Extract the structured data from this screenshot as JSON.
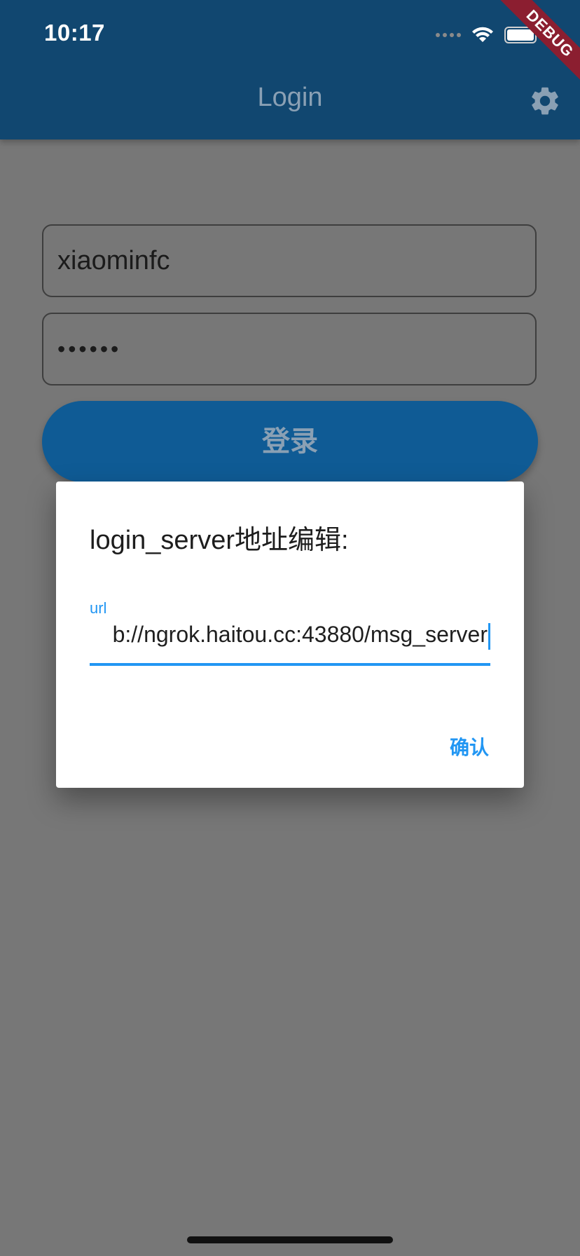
{
  "status_bar": {
    "time": "10:17"
  },
  "app_bar": {
    "title": "Login",
    "debug_banner": "DEBUG",
    "background_color": "#114770"
  },
  "login_form": {
    "username": "xiaominfc",
    "password_masked": "••••••",
    "login_label": "登录"
  },
  "dialog": {
    "title": "login_server地址编辑:",
    "url_field": {
      "label": "url",
      "value": "b://ngrok.haitou.cc:43880/msg_server"
    },
    "confirm_label": "确认",
    "accent_color": "#2196f3"
  },
  "icons": {
    "settings": "gear-icon",
    "wifi": "wifi-icon",
    "battery": "battery-icon",
    "signal": "signal-dots-icon"
  }
}
